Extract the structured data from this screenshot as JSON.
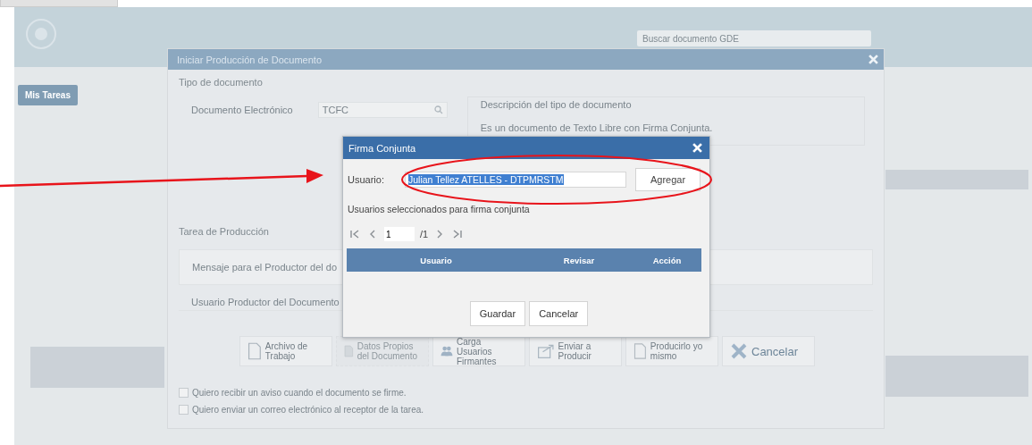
{
  "app": {
    "search_placeholder": "Buscar documento GDE",
    "tabs": [
      {
        "label": "Mis Tareas",
        "selected": true
      }
    ]
  },
  "production_dialog": {
    "title": "Iniciar Producción de Documento",
    "type_section": "Tipo de documento",
    "doc_label": "Documento Electrónico",
    "doc_value": "TCFC",
    "desc_legend": "Descripción del tipo de documento",
    "desc_text": "Es un documento de Texto Libre con Firma Conjunta.",
    "task_section": "Tarea de Producción",
    "message_label": "Mensaje para el Productor del do",
    "producer_label": "Usuario Productor del Documento",
    "actions": [
      {
        "kind": "file",
        "label": "Archivo de Trabajo",
        "disabled": false
      },
      {
        "kind": "doc",
        "label": "Datos Propios del Documento",
        "disabled": true
      },
      {
        "kind": "users",
        "label": "Carga Usuarios Firmantes",
        "disabled": false
      },
      {
        "kind": "send",
        "label": "Enviar a Producir",
        "disabled": false
      },
      {
        "kind": "page",
        "label": "Producirlo yo mismo",
        "disabled": false
      },
      {
        "kind": "cancel",
        "label": "Cancelar",
        "disabled": false
      }
    ],
    "options": [
      {
        "label": "Quiero recibir un aviso cuando el documento se firme.",
        "checked": false
      },
      {
        "label": "Quiero enviar un correo electrónico al receptor de la tarea.",
        "checked": false
      }
    ]
  },
  "cosign_dialog": {
    "title": "Firma Conjunta",
    "user_label": "Usuario:",
    "user_value": "Julian Tellez ATELLES - DTPMRSTM",
    "user_value_selected": true,
    "add_button": "Agregar",
    "selected_label": "Usuarios seleccionados para firma conjunta",
    "pager": {
      "page": "1",
      "total": "/1"
    },
    "columns": [
      "Usuario",
      "Revisar",
      "Acción"
    ],
    "buttons": [
      "Guardar",
      "Cancelar"
    ]
  }
}
